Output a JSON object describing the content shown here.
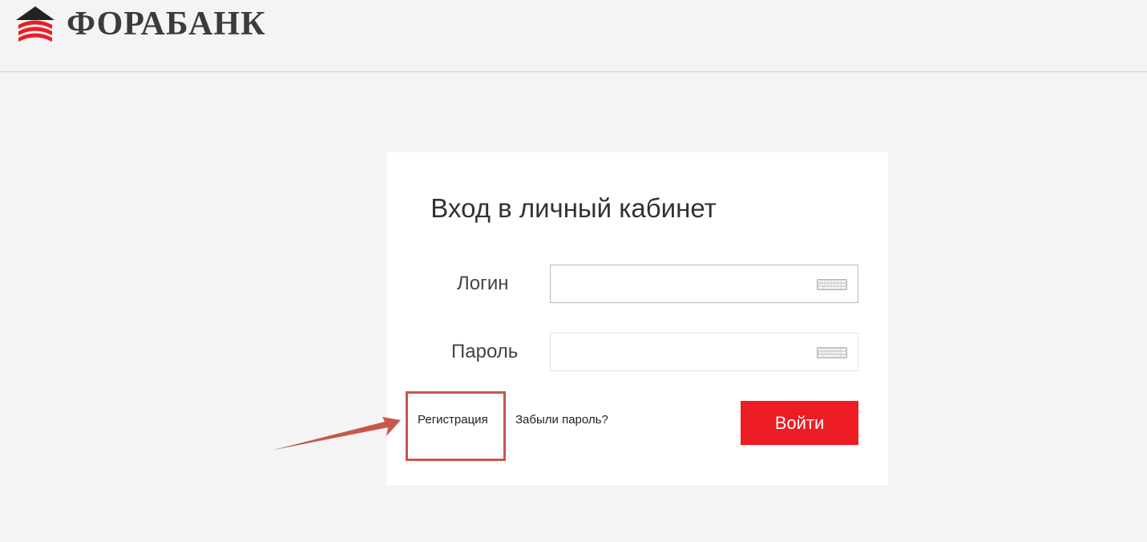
{
  "header": {
    "brand_name": "ФОРАБАНК",
    "logo_icon": "forabank-logo-icon"
  },
  "login_form": {
    "title": "Вход в личный кабинет",
    "login_label": "Логин",
    "login_value": "",
    "password_label": "Пароль",
    "password_value": "",
    "input_icon": "keyboard-icon",
    "register_link": "Регистрация",
    "forgot_password_link": "Забыли пароль?",
    "submit_label": "Войти"
  },
  "annotation": {
    "highlight_color": "#c8574b",
    "arrow_color": "#c8574b",
    "target": "register_link"
  },
  "colors": {
    "brand_red": "#ee1c25",
    "page_background": "#f4f4f4",
    "card_background": "#ffffff",
    "text_dark": "#333333"
  }
}
